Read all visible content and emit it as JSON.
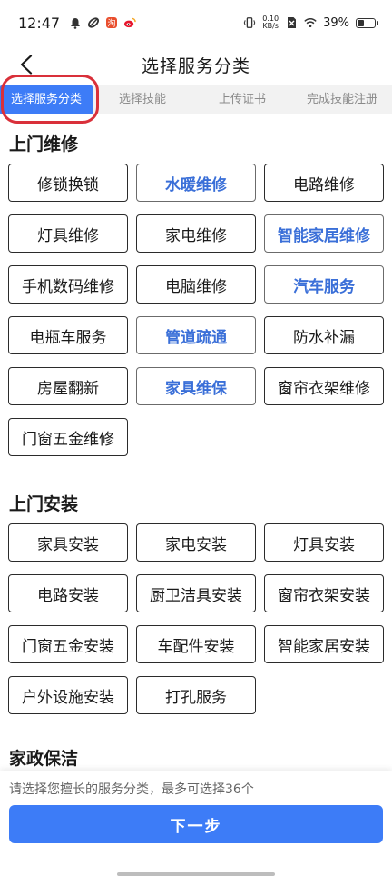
{
  "status_bar": {
    "time": "12:47",
    "speed_value": "0.10",
    "speed_unit": "KB/s",
    "battery_text": "39%",
    "battery_level": 0.39
  },
  "nav": {
    "title": "选择服务分类"
  },
  "steps": [
    {
      "label": "选择服务分类",
      "active": true
    },
    {
      "label": "选择技能",
      "active": false
    },
    {
      "label": "上传证书",
      "active": false
    },
    {
      "label": "完成技能注册",
      "active": false
    }
  ],
  "sections": [
    {
      "title": "上门维修",
      "items": [
        {
          "label": "修锁换锁",
          "hl": false
        },
        {
          "label": "水暖维修",
          "hl": true
        },
        {
          "label": "电路维修",
          "hl": false
        },
        {
          "label": "灯具维修",
          "hl": false
        },
        {
          "label": "家电维修",
          "hl": false
        },
        {
          "label": "智能家居维修",
          "hl": true
        },
        {
          "label": "手机数码维修",
          "hl": false
        },
        {
          "label": "电脑维修",
          "hl": false
        },
        {
          "label": "汽车服务",
          "hl": true
        },
        {
          "label": "电瓶车服务",
          "hl": false
        },
        {
          "label": "管道疏通",
          "hl": true
        },
        {
          "label": "防水补漏",
          "hl": false
        },
        {
          "label": "房屋翻新",
          "hl": false
        },
        {
          "label": "家具维保",
          "hl": true
        },
        {
          "label": "窗帘衣架维修",
          "hl": false
        },
        {
          "label": "门窗五金维修",
          "hl": false
        }
      ]
    },
    {
      "title": "上门安装",
      "items": [
        {
          "label": "家具安装",
          "hl": false
        },
        {
          "label": "家电安装",
          "hl": false
        },
        {
          "label": "灯具安装",
          "hl": false
        },
        {
          "label": "电路安装",
          "hl": false
        },
        {
          "label": "厨卫洁具安装",
          "hl": false
        },
        {
          "label": "窗帘衣架安装",
          "hl": false
        },
        {
          "label": "门窗五金安装",
          "hl": false
        },
        {
          "label": "车配件安装",
          "hl": false
        },
        {
          "label": "智能家居安装",
          "hl": false
        },
        {
          "label": "户外设施安装",
          "hl": false
        },
        {
          "label": "打孔服务",
          "hl": false
        }
      ]
    },
    {
      "title": "家政保洁",
      "items": []
    }
  ],
  "bottom": {
    "hint": "请选择您擅长的服务分类，最多可选择36个",
    "next_label": "下一步"
  },
  "colors": {
    "accent": "#3d7cf7",
    "highlight_text": "#3a6fd8",
    "annotation": "#d9303a"
  }
}
